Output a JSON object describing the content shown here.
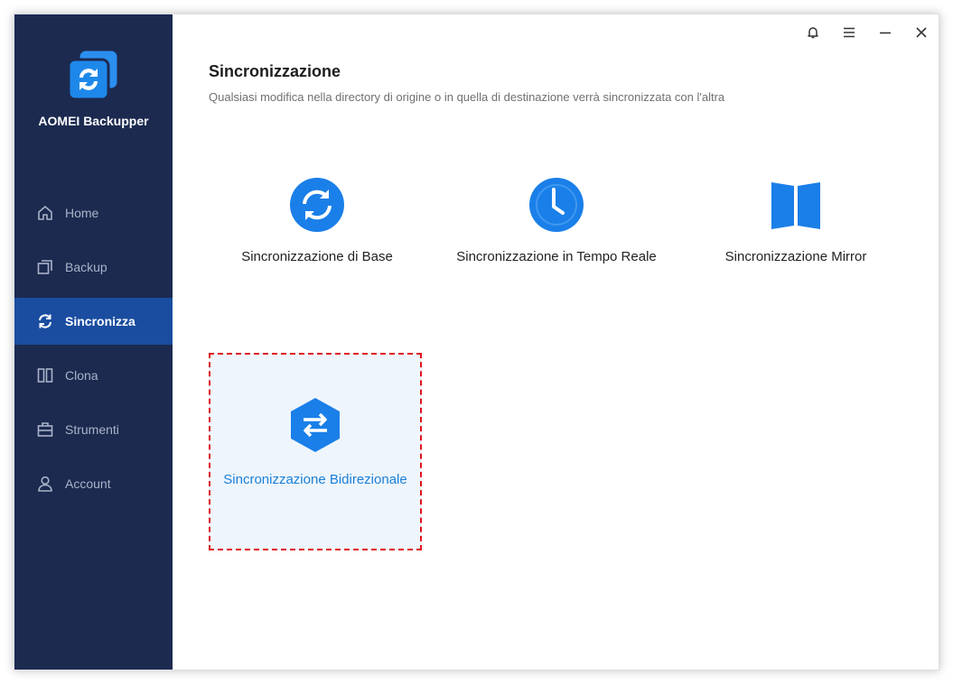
{
  "app": {
    "name": "AOMEI Backupper"
  },
  "sidebar": {
    "items": [
      {
        "label": "Home",
        "icon": "home-icon",
        "active": false
      },
      {
        "label": "Backup",
        "icon": "backup-icon",
        "active": false
      },
      {
        "label": "Sincronizza",
        "icon": "sync-icon",
        "active": true
      },
      {
        "label": "Clona",
        "icon": "clone-icon",
        "active": false
      },
      {
        "label": "Strumenti",
        "icon": "tools-icon",
        "active": false
      },
      {
        "label": "Account",
        "icon": "user-icon",
        "active": false
      }
    ]
  },
  "titlebar": {
    "buttons": [
      "bell-icon",
      "menu-icon",
      "minimize-icon",
      "close-icon"
    ]
  },
  "main": {
    "title": "Sincronizzazione",
    "subtitle": "Qualsiasi modifica nella directory di origine o in quella di destinazione verrà sincronizzata con l'altra",
    "options": [
      {
        "label": "Sincronizzazione di Base",
        "icon": "sync-circle-icon"
      },
      {
        "label": "Sincronizzazione in Tempo Reale",
        "icon": "clock-icon"
      },
      {
        "label": "Sincronizzazione Mirror",
        "icon": "mirror-icon"
      },
      {
        "label": "Sincronizzazione Bidirezionale",
        "icon": "two-way-sync-icon",
        "highlighted": true
      }
    ]
  },
  "colors": {
    "sidebar_bg": "#1c2a50",
    "sidebar_active": "#1a4da0",
    "accent": "#1a7fd6",
    "highlight_border": "#e0141e"
  }
}
